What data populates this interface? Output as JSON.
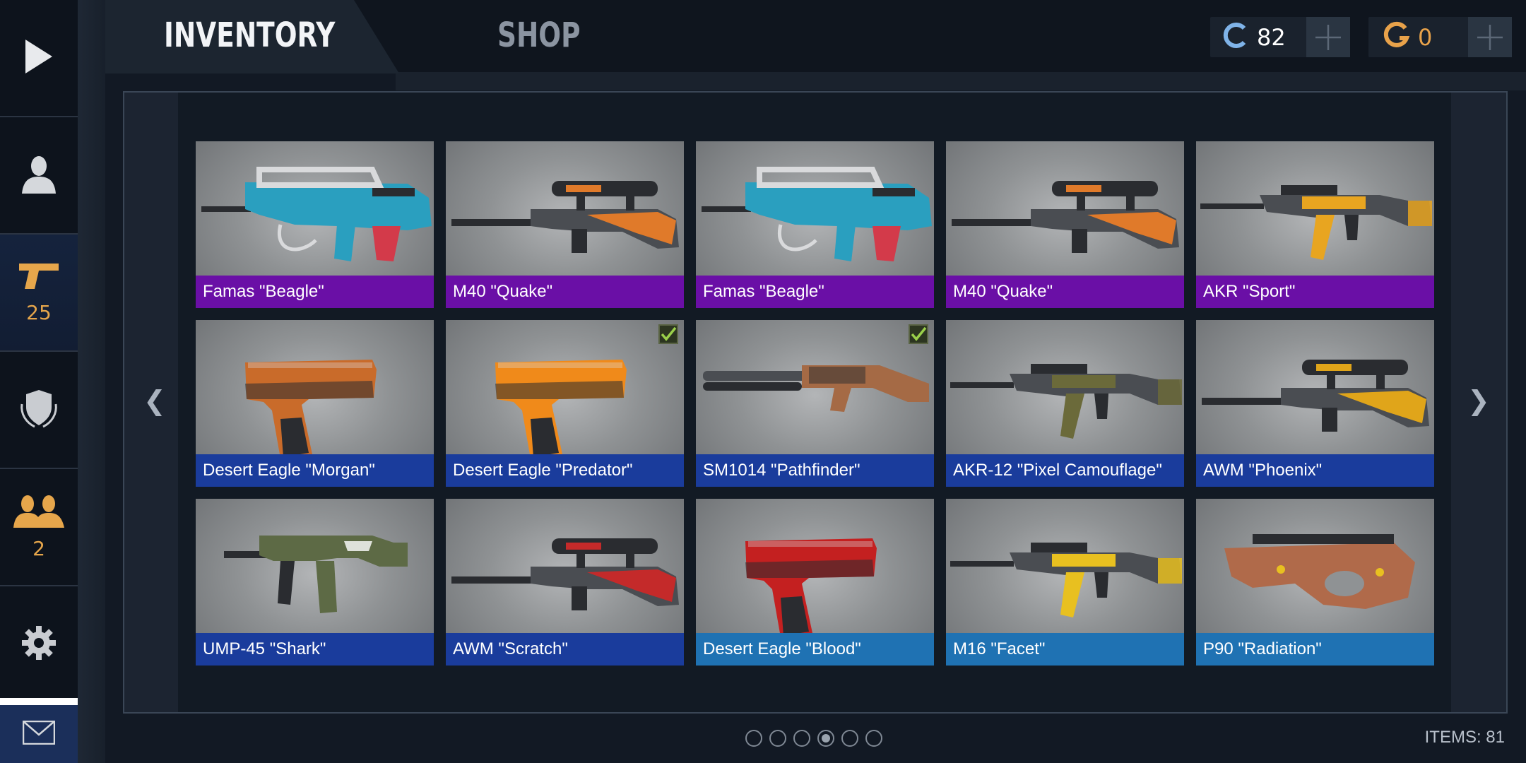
{
  "header": {
    "tabs": [
      {
        "label": "INVENTORY",
        "active": true
      },
      {
        "label": "SHOP",
        "active": false
      }
    ],
    "currencies": [
      {
        "icon": "credits-icon",
        "value": "82",
        "color": "#7fb3e8"
      },
      {
        "icon": "gold-icon",
        "value": "0",
        "color": "#e8a24a"
      }
    ]
  },
  "sidebar": {
    "items": [
      {
        "name": "play",
        "icon": "play-icon"
      },
      {
        "name": "profile",
        "icon": "profile-icon"
      },
      {
        "name": "weapons",
        "icon": "pistol-icon",
        "count": "25",
        "active": true
      },
      {
        "name": "ranks",
        "icon": "shield-icon"
      },
      {
        "name": "friends",
        "icon": "friends-icon",
        "count": "2"
      },
      {
        "name": "settings",
        "icon": "gear-icon"
      },
      {
        "name": "mail",
        "icon": "mail-icon"
      }
    ]
  },
  "rarity_colors": {
    "epic": "#6a0fa6",
    "rare": "#1a3c9c",
    "uncommon": "#1f72b3"
  },
  "inventory": {
    "items": [
      {
        "name": "Famas \"Beagle\"",
        "rarity": "epic",
        "weapon": "rifle-bullpup",
        "accent": "#2a9fbf",
        "equipped": false
      },
      {
        "name": "M40 \"Quake\"",
        "rarity": "epic",
        "weapon": "sniper",
        "accent": "#e07a2a",
        "equipped": false
      },
      {
        "name": "Famas \"Beagle\"",
        "rarity": "epic",
        "weapon": "rifle-bullpup",
        "accent": "#2a9fbf",
        "equipped": false
      },
      {
        "name": "M40 \"Quake\"",
        "rarity": "epic",
        "weapon": "sniper",
        "accent": "#e07a2a",
        "equipped": false
      },
      {
        "name": "AKR \"Sport\"",
        "rarity": "epic",
        "weapon": "assault",
        "accent": "#e8a520",
        "equipped": false
      },
      {
        "name": "Desert Eagle \"Morgan\"",
        "rarity": "rare",
        "weapon": "pistol",
        "accent": "#c96b2a",
        "equipped": false
      },
      {
        "name": "Desert Eagle \"Predator\"",
        "rarity": "rare",
        "weapon": "pistol",
        "accent": "#f08a1a",
        "equipped": true
      },
      {
        "name": "SM1014 \"Pathfinder\"",
        "rarity": "rare",
        "weapon": "shotgun",
        "accent": "#a56a45",
        "equipped": true
      },
      {
        "name": "AKR-12 \"Pixel Camouflage\"",
        "rarity": "rare",
        "weapon": "assault",
        "accent": "#6b6a3a",
        "equipped": false
      },
      {
        "name": "AWM \"Phoenix\"",
        "rarity": "rare",
        "weapon": "sniper",
        "accent": "#e0a51a",
        "equipped": false
      },
      {
        "name": "UMP-45 \"Shark\"",
        "rarity": "rare",
        "weapon": "smg",
        "accent": "#5d6a45",
        "equipped": false
      },
      {
        "name": "AWM \"Scratch\"",
        "rarity": "rare",
        "weapon": "sniper",
        "accent": "#c42a2a",
        "equipped": false
      },
      {
        "name": "Desert Eagle \"Blood\"",
        "rarity": "uncommon",
        "weapon": "pistol",
        "accent": "#c42020",
        "equipped": false
      },
      {
        "name": "M16 \"Facet\"",
        "rarity": "uncommon",
        "weapon": "assault",
        "accent": "#e8c020",
        "equipped": false
      },
      {
        "name": "P90 \"Radiation\"",
        "rarity": "uncommon",
        "weapon": "smg-p90",
        "accent": "#b06a4a",
        "equipped": false
      }
    ]
  },
  "pagination": {
    "pages": 6,
    "current": 4
  },
  "footer": {
    "items_count": "ITEMS: 81"
  }
}
